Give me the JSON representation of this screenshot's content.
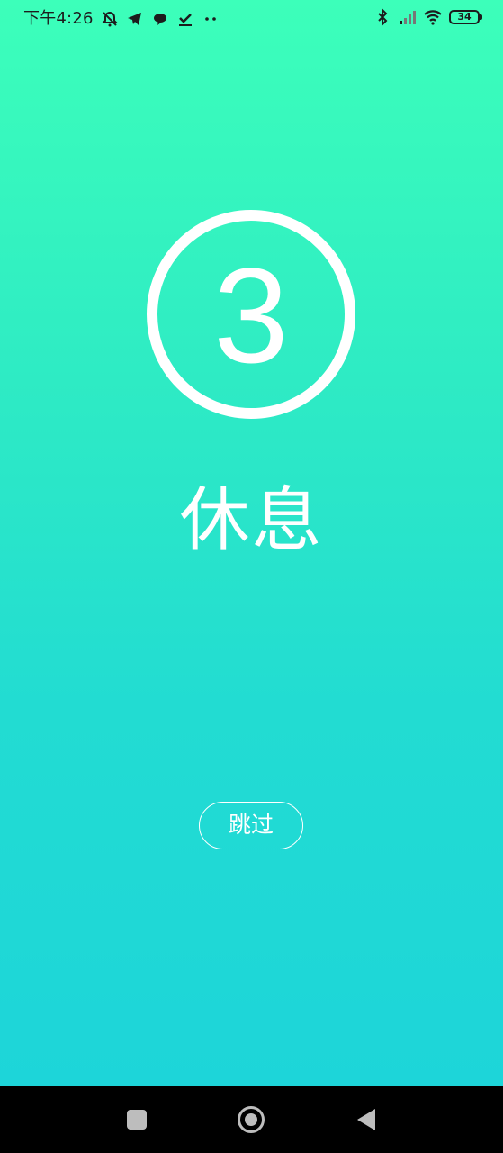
{
  "status_bar": {
    "time": "下午4:26",
    "battery_level": "34",
    "left_icons": [
      "muted-bell-icon",
      "telegram-icon",
      "chat-bubble-icon",
      "task-check-icon",
      "more-dots-icon"
    ],
    "right_icons": [
      "bluetooth-icon",
      "cellular-signal-icon",
      "wifi-icon",
      "battery-icon"
    ]
  },
  "countdown": {
    "value": "3"
  },
  "state": {
    "label": "休息"
  },
  "actions": {
    "skip_label": "跳过"
  },
  "nav_bar": {
    "icons": [
      "recent-apps-icon",
      "home-icon",
      "back-icon"
    ]
  },
  "colors": {
    "gradient_top": "#3cffba",
    "gradient_bottom": "#1dd5d9",
    "foreground": "#ffffff"
  }
}
